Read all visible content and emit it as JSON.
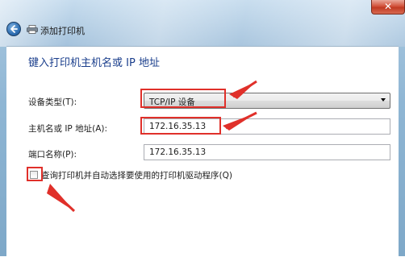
{
  "window": {
    "title": "添加打印机",
    "close_glyph": "✕"
  },
  "dialog": {
    "heading": "键入打印机主机名或 IP 地址",
    "device_type": {
      "label": "设备类型(T):",
      "value": "TCP/IP 设备"
    },
    "hostname": {
      "label": "主机名或 IP 地址(A):",
      "value": "172.16.35.13"
    },
    "port_name": {
      "label": "端口名称(P):",
      "value": "172.16.35.13"
    },
    "query_checkbox": {
      "label": "查询打印机并自动选择要使用的打印机驱动程序(Q)",
      "checked": false
    }
  },
  "annotation_color": "#e0302a",
  "icons": {
    "back": "back-arrow-icon",
    "printer": "printer-icon",
    "dropdown": "chevron-down-icon"
  }
}
